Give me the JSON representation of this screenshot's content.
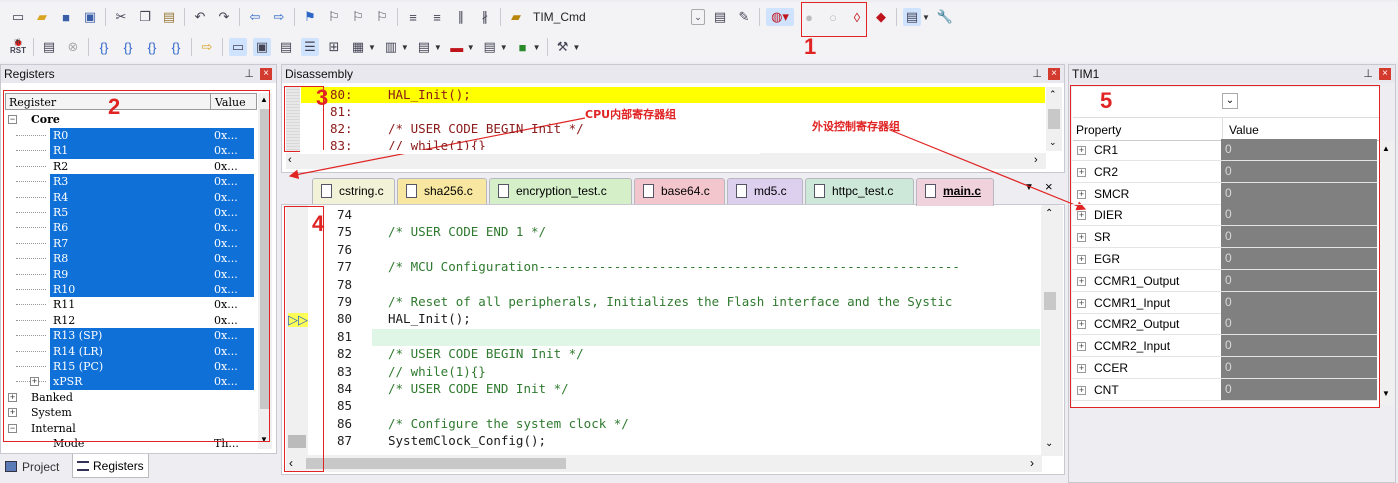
{
  "toolbar1": {
    "target_combo": "TIM_Cmd"
  },
  "toolbar2": {
    "rst_label": "RST"
  },
  "registers_panel": {
    "title": "Registers",
    "col_register": "Register",
    "col_value": "Value",
    "core_label": "Core",
    "rows": [
      {
        "name": "R0",
        "value": "0x..."
      },
      {
        "name": "R1",
        "value": "0x..."
      },
      {
        "name": "R2",
        "value": "0x..."
      },
      {
        "name": "R3",
        "value": "0x..."
      },
      {
        "name": "R4",
        "value": "0x..."
      },
      {
        "name": "R5",
        "value": "0x..."
      },
      {
        "name": "R6",
        "value": "0x..."
      },
      {
        "name": "R7",
        "value": "0x..."
      },
      {
        "name": "R8",
        "value": "0x..."
      },
      {
        "name": "R9",
        "value": "0x..."
      },
      {
        "name": "R10",
        "value": "0x..."
      },
      {
        "name": "R11",
        "value": "0x..."
      },
      {
        "name": "R12",
        "value": "0x..."
      },
      {
        "name": "R13 (SP)",
        "value": "0x..."
      },
      {
        "name": "R14 (LR)",
        "value": "0x..."
      },
      {
        "name": "R15 (PC)",
        "value": "0x..."
      },
      {
        "name": "xPSR",
        "value": "0x..."
      }
    ],
    "groups": [
      "Banked",
      "System",
      "Internal"
    ],
    "mode_name": "Mode",
    "mode_value": "Th..."
  },
  "bottom_tabs": {
    "project": "Project",
    "registers": "Registers"
  },
  "disassembly": {
    "title": "Disassembly",
    "lines": [
      {
        "num": "80:",
        "code": "HAL_Init();"
      },
      {
        "num": "81:",
        "code": ""
      },
      {
        "num": "82:",
        "code": "/* USER CODE BEGIN Init */"
      },
      {
        "num": "83:",
        "code": "// while(1){}"
      }
    ]
  },
  "editor_tabs": [
    "cstring.c",
    "sha256.c",
    "encryption_test.c",
    "base64.c",
    "md5.c",
    "httpc_test.c",
    "main.c"
  ],
  "editor_lines": [
    {
      "num": "74",
      "code": ""
    },
    {
      "num": "75",
      "code": "/* USER CODE END 1 */"
    },
    {
      "num": "76",
      "code": ""
    },
    {
      "num": "77",
      "code": "/* MCU Configuration--------------------------------------------------------"
    },
    {
      "num": "78",
      "code": ""
    },
    {
      "num": "79",
      "code": "/* Reset of all peripherals, Initializes the Flash interface and the Systic"
    },
    {
      "num": "80",
      "code": "HAL_Init();"
    },
    {
      "num": "81",
      "code": ""
    },
    {
      "num": "82",
      "code": "/* USER CODE BEGIN Init */"
    },
    {
      "num": "83",
      "code": "// while(1){}"
    },
    {
      "num": "84",
      "code": "/* USER CODE END Init */"
    },
    {
      "num": "85",
      "code": ""
    },
    {
      "num": "86",
      "code": "/* Configure the system clock */"
    },
    {
      "num": "87",
      "code": "SystemClock_Config();"
    }
  ],
  "tim1_panel": {
    "title": "TIM1",
    "col_property": "Property",
    "col_value": "Value",
    "rows": [
      {
        "name": "CR1",
        "value": "0"
      },
      {
        "name": "CR2",
        "value": "0"
      },
      {
        "name": "SMCR",
        "value": "0"
      },
      {
        "name": "DIER",
        "value": "0"
      },
      {
        "name": "SR",
        "value": "0"
      },
      {
        "name": "EGR",
        "value": "0"
      },
      {
        "name": "CCMR1_Output",
        "value": "0"
      },
      {
        "name": "CCMR1_Input",
        "value": "0"
      },
      {
        "name": "CCMR2_Output",
        "value": "0"
      },
      {
        "name": "CCMR2_Input",
        "value": "0"
      },
      {
        "name": "CCER",
        "value": "0"
      },
      {
        "name": "CNT",
        "value": "0"
      }
    ]
  },
  "annotations": {
    "n1": "1",
    "n2": "2",
    "n3": "3",
    "n4": "4",
    "n5": "5",
    "cpu_label": "CPU内部寄存器组",
    "periph_label": "外设控制寄存器组",
    "color": "#e02424"
  }
}
